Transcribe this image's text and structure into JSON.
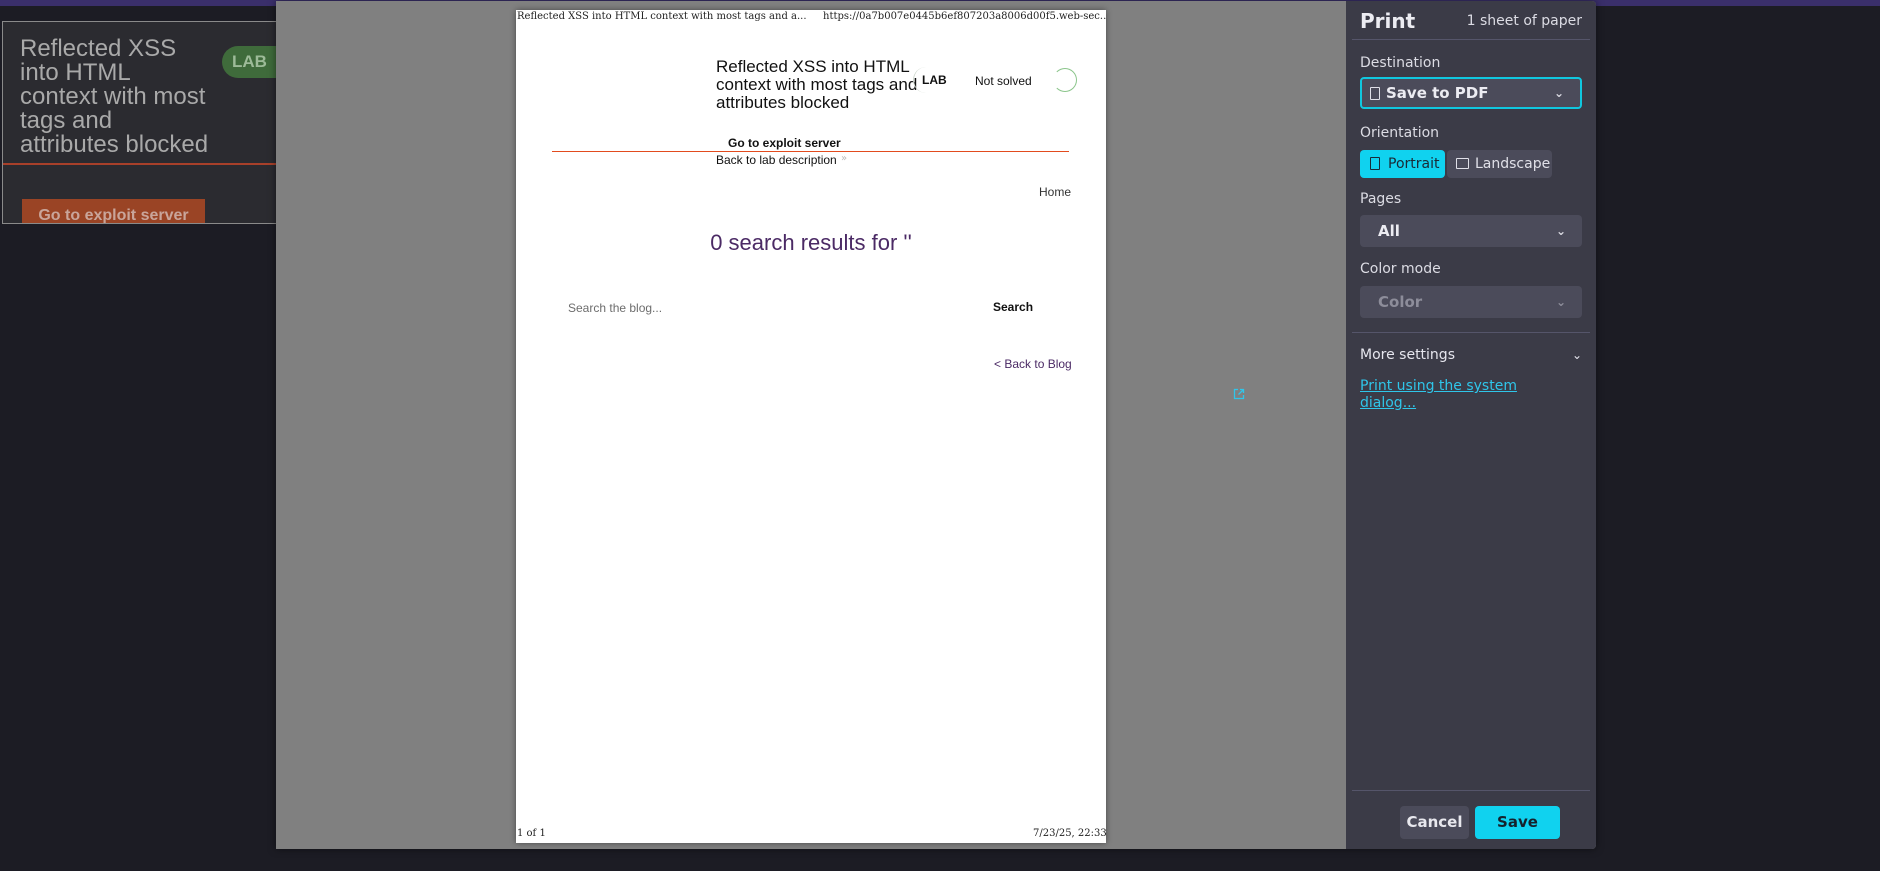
{
  "background_page": {
    "lab_title": "Reflected XSS into HTML context with most tags and attributes blocked",
    "lab_badge": "LAB",
    "exploit_button": "Go to exploit server"
  },
  "preview": {
    "header_title": "Reflected XSS into HTML context with most tags and a...",
    "header_url": "https://0a7b007e0445b6ef807203a8006d00f5.web-sec...",
    "footer_page": "1 of 1",
    "footer_date": "7/23/25, 22:33",
    "lab_title": "Reflected XSS into HTML context with most tags and attributes blocked",
    "lab_badge": "LAB",
    "status": "Not solved",
    "exploit_link": "Go to exploit server",
    "back_to_description": "Back to lab description",
    "home_link": "Home",
    "results_heading": "0 search results for ''",
    "search_placeholder": "Search the blog...",
    "search_button": "Search",
    "back_to_blog": "< Back to Blog"
  },
  "settings": {
    "title": "Print",
    "sheet_count": "1 sheet of paper",
    "destination_label": "Destination",
    "destination_value": "Save to PDF",
    "orientation_label": "Orientation",
    "orientation_portrait": "Portrait",
    "orientation_landscape": "Landscape",
    "orientation_selected": "Portrait",
    "pages_label": "Pages",
    "pages_value": "All",
    "color_mode_label": "Color mode",
    "color_mode_value": "Color",
    "more_settings": "More settings",
    "system_dialog_link": "Print using the system dialog...",
    "cancel": "Cancel",
    "save": "Save"
  },
  "icons": {
    "destination": "document-icon",
    "portrait": "portrait-page-icon",
    "landscape": "landscape-page-icon",
    "dropdown": "chevron-down-icon",
    "external": "external-link-icon",
    "status": "status-spinner-icon"
  },
  "colors": {
    "accent": "#10d2ef",
    "panel_bg": "#3b3b47",
    "preview_bg": "#808080",
    "results_heading": "#4b2a65",
    "lab_red": "#e24b1e"
  }
}
